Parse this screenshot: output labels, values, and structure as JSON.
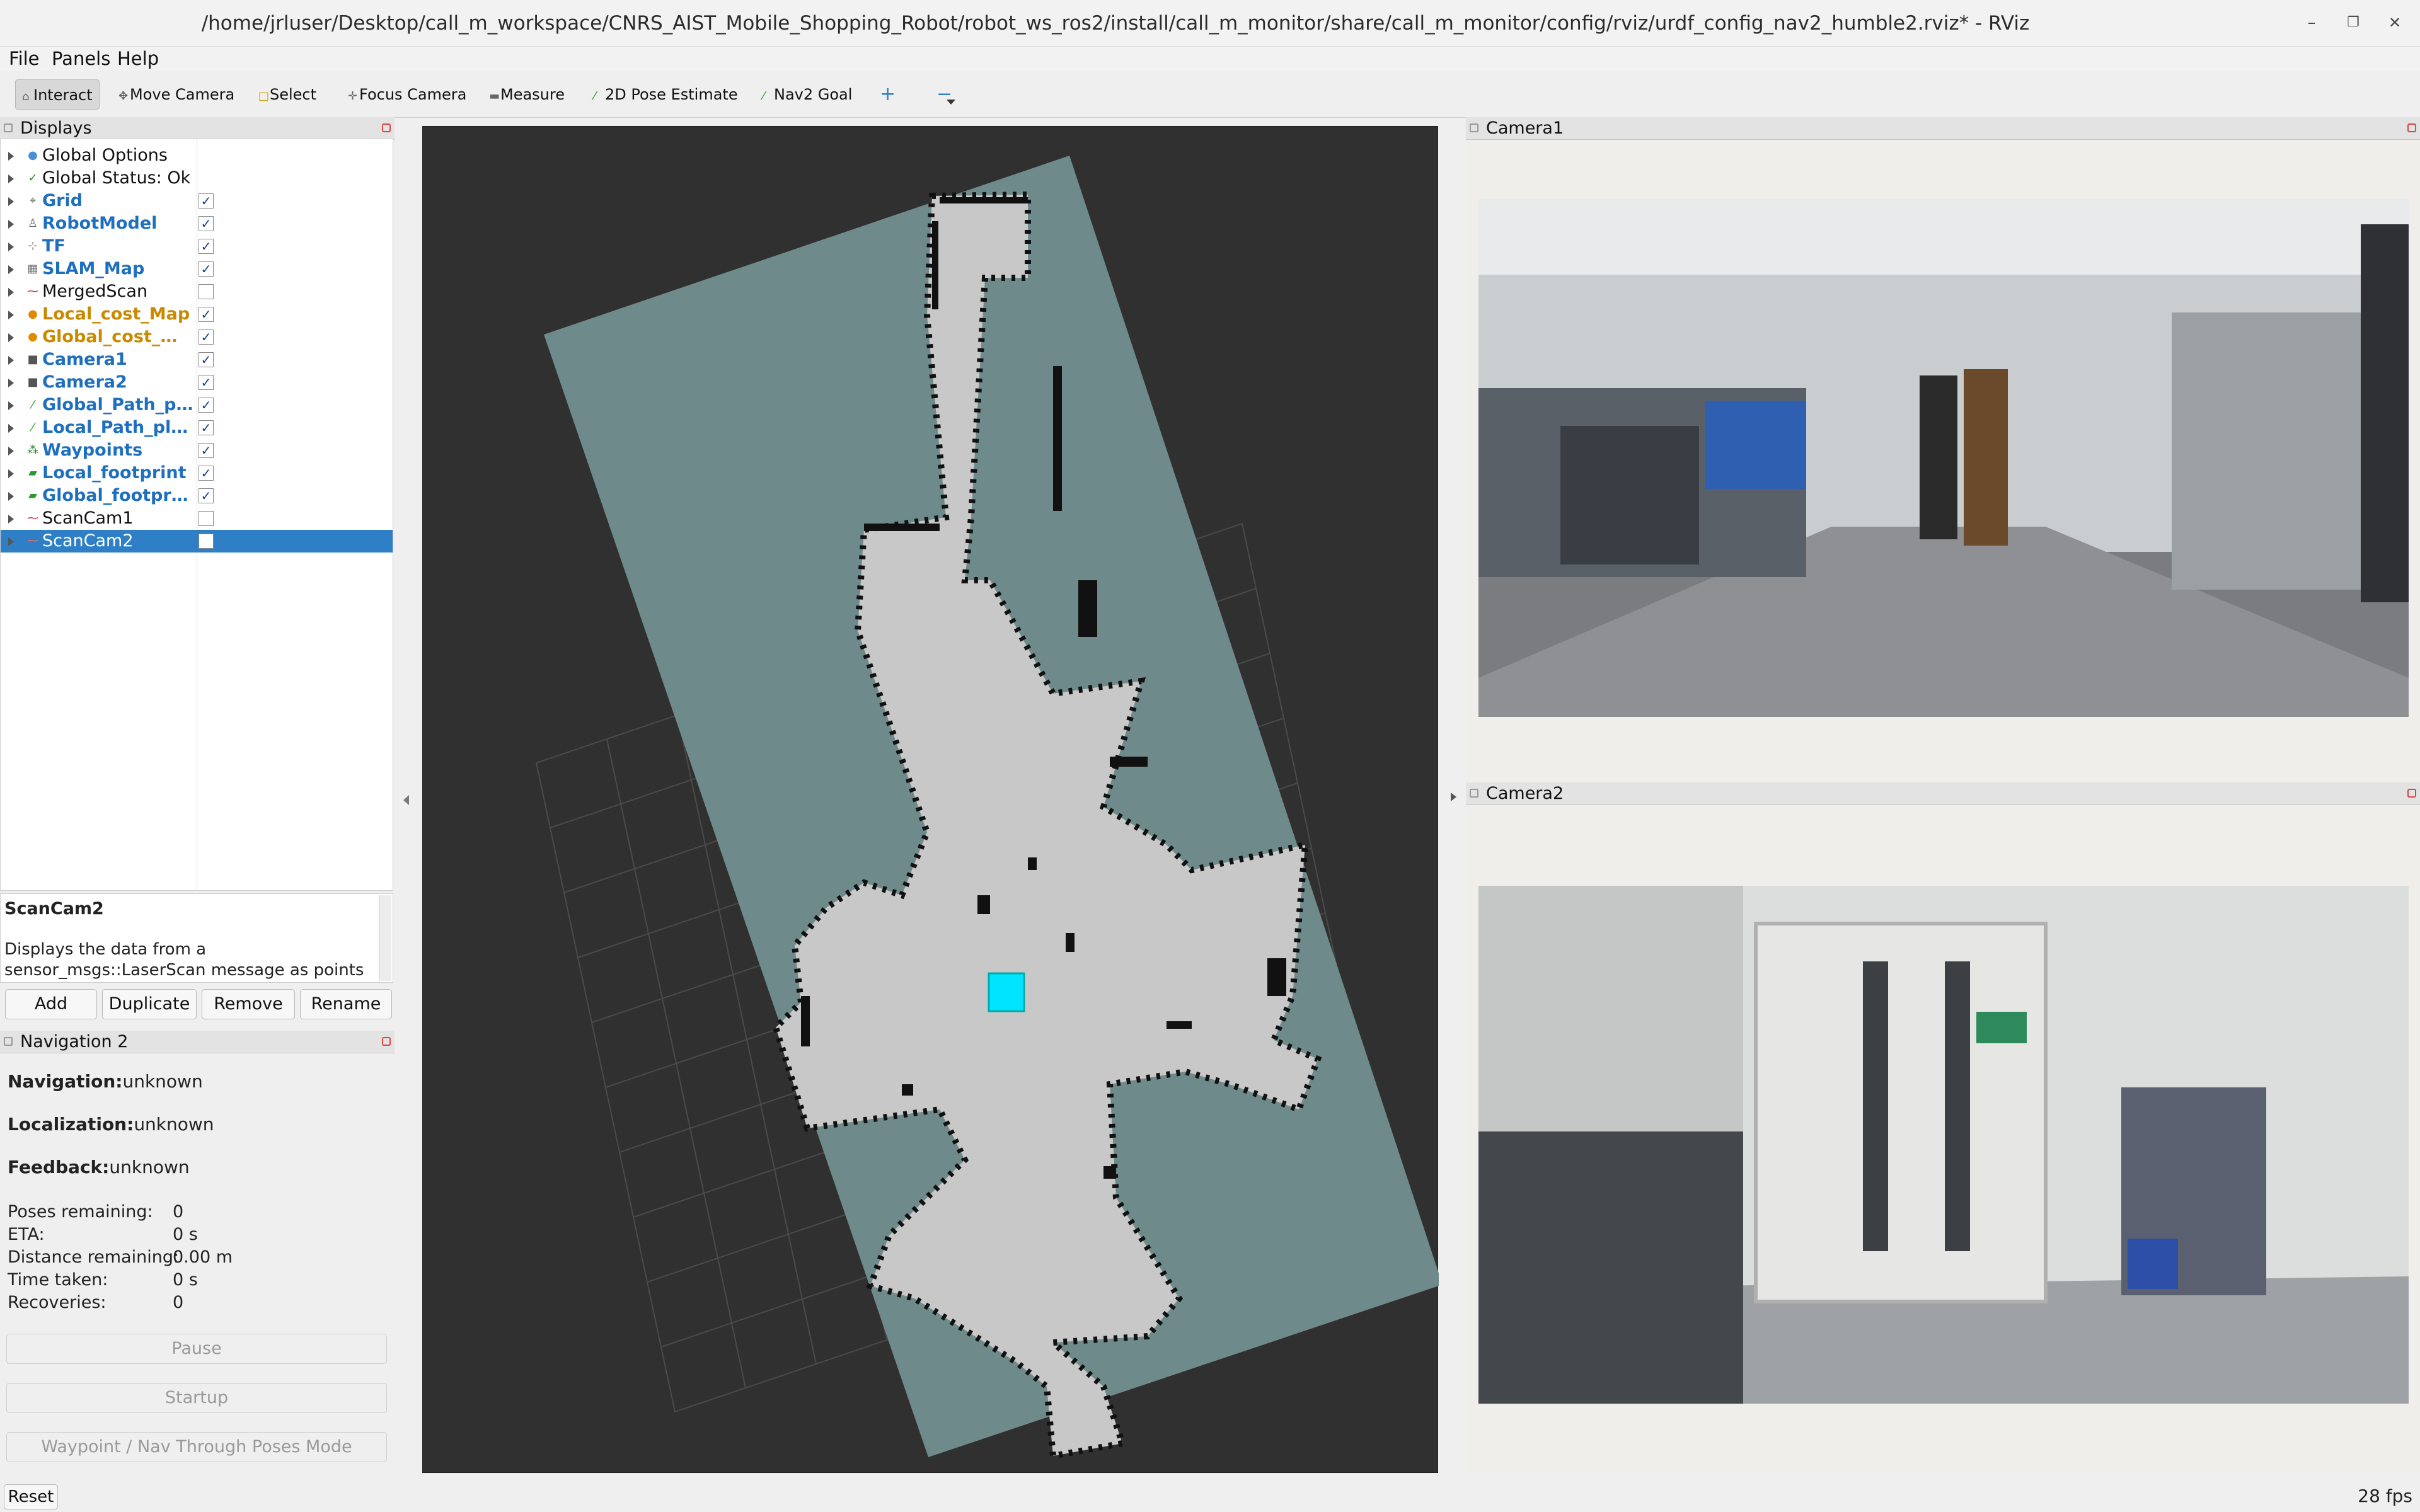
{
  "window": {
    "title": "/home/jrluser/Desktop/call_m_workspace/CNRS_AIST_Mobile_Shopping_Robot/robot_ws_ros2/install/call_m_monitor/share/call_m_monitor/config/rviz/urdf_config_nav2_humble2.rviz* - RViz",
    "minimize": "–",
    "maximize": "❐",
    "close": "✕"
  },
  "menu": [
    "File",
    "Panels",
    "Help"
  ],
  "toolbar": {
    "interact": "Interact",
    "move_camera": "Move Camera",
    "select": "Select",
    "focus_camera": "Focus Camera",
    "measure": "Measure",
    "pose_estimate": "2D Pose Estimate",
    "nav2_goal": "Nav2 Goal",
    "plus": "+",
    "minus": "−"
  },
  "displays": {
    "header": "Displays",
    "items": [
      {
        "label": "Global Options",
        "checked": null,
        "color": "#111111",
        "icon": "globe-icon",
        "glyph": "●",
        "icolor": "#4a90d9"
      },
      {
        "label": "Global Status: Ok",
        "checked": null,
        "color": "#111111",
        "icon": "check-icon",
        "glyph": "✓",
        "icolor": "#2a8a2a"
      },
      {
        "label": "Grid",
        "checked": true,
        "color": "#1f6fbf",
        "icon": "grid-icon",
        "glyph": "⌖",
        "icolor": "#666666"
      },
      {
        "label": "RobotModel",
        "checked": true,
        "color": "#1f6fbf",
        "icon": "robot-icon",
        "glyph": "♙",
        "icolor": "#666666"
      },
      {
        "label": "TF",
        "checked": true,
        "color": "#1f6fbf",
        "icon": "tf-axes-icon",
        "glyph": "⊹",
        "icolor": "#888888"
      },
      {
        "label": "SLAM_Map",
        "checked": true,
        "color": "#1f6fbf",
        "icon": "map-icon",
        "glyph": "▦",
        "icolor": "#666666"
      },
      {
        "label": "MergedScan",
        "checked": false,
        "color": "#111111",
        "icon": "laser-scan-icon",
        "glyph": "⁓",
        "icolor": "#cc3333"
      },
      {
        "label": "Local_cost_Map",
        "checked": true,
        "color": "#c98a00",
        "icon": "warning-dot-icon",
        "glyph": "●",
        "icolor": "#e08a00"
      },
      {
        "label": "Global_cost_Map",
        "checked": true,
        "color": "#c98a00",
        "icon": "warning-dot-icon",
        "glyph": "●",
        "icolor": "#e08a00"
      },
      {
        "label": "Camera1",
        "checked": true,
        "color": "#1f6fbf",
        "icon": "camera-icon",
        "glyph": "■",
        "icolor": "#555555"
      },
      {
        "label": "Camera2",
        "checked": true,
        "color": "#1f6fbf",
        "icon": "camera-icon",
        "glyph": "■",
        "icolor": "#555555"
      },
      {
        "label": "Global_Path_pl...",
        "checked": true,
        "color": "#1f6fbf",
        "icon": "path-icon",
        "glyph": "⁄",
        "icolor": "#2a9a2a"
      },
      {
        "label": "Local_Path_pla...",
        "checked": true,
        "color": "#1f6fbf",
        "icon": "path-icon",
        "glyph": "⁄",
        "icolor": "#2a9a2a"
      },
      {
        "label": "Waypoints",
        "checked": true,
        "color": "#1f6fbf",
        "icon": "waypoints-icon",
        "glyph": "⁂",
        "icolor": "#2a7a2a"
      },
      {
        "label": "Local_footprint",
        "checked": true,
        "color": "#1f6fbf",
        "icon": "footprint-icon",
        "glyph": "▰",
        "icolor": "#2a9a2a"
      },
      {
        "label": "Global_footprint",
        "checked": true,
        "color": "#1f6fbf",
        "icon": "footprint-icon",
        "glyph": "▰",
        "icolor": "#2a9a2a"
      },
      {
        "label": "ScanCam1",
        "checked": false,
        "color": "#111111",
        "icon": "laser-scan-icon",
        "glyph": "⁓",
        "icolor": "#cc3333"
      },
      {
        "label": "ScanCam2",
        "checked": false,
        "color": "#ffffff",
        "icon": "laser-scan-icon",
        "glyph": "⁓",
        "icolor": "#ff6666",
        "selected": true
      }
    ],
    "description_title": "ScanCam2",
    "description_body": "Displays the data from a sensor_msgs::LaserScan message as points",
    "buttons": {
      "add": "Add",
      "duplicate": "Duplicate",
      "remove": "Remove",
      "rename": "Rename"
    }
  },
  "nav2": {
    "header": "Navigation 2",
    "navigation_label": "Navigation:",
    "navigation_value": "unknown",
    "localization_label": "Localization:",
    "localization_value": "unknown",
    "feedback_label": "Feedback:",
    "feedback_value": "unknown",
    "stats": [
      {
        "label": "Poses remaining:",
        "value": "0"
      },
      {
        "label": "ETA:",
        "value": "0 s"
      },
      {
        "label": "Distance remaining:",
        "value": "0.00 m"
      },
      {
        "label": "Time taken:",
        "value": "0 s"
      },
      {
        "label": "Recoveries:",
        "value": "0"
      }
    ],
    "pause": "Pause",
    "startup": "Startup",
    "waypoint_mode": "Waypoint / Nav Through Poses Mode"
  },
  "cameras": {
    "camera1_title": "Camera1",
    "camera2_title": "Camera2"
  },
  "status": {
    "reset": "Reset",
    "fps": "28 fps"
  },
  "colors": {
    "selection": "#2f7fc7",
    "map_unknown": "#6f8a8a",
    "map_free": "#c8c8c8",
    "map_occupied": "#111111",
    "robot_footprint": "#00e5ff",
    "viewport_bg": "#303030"
  }
}
